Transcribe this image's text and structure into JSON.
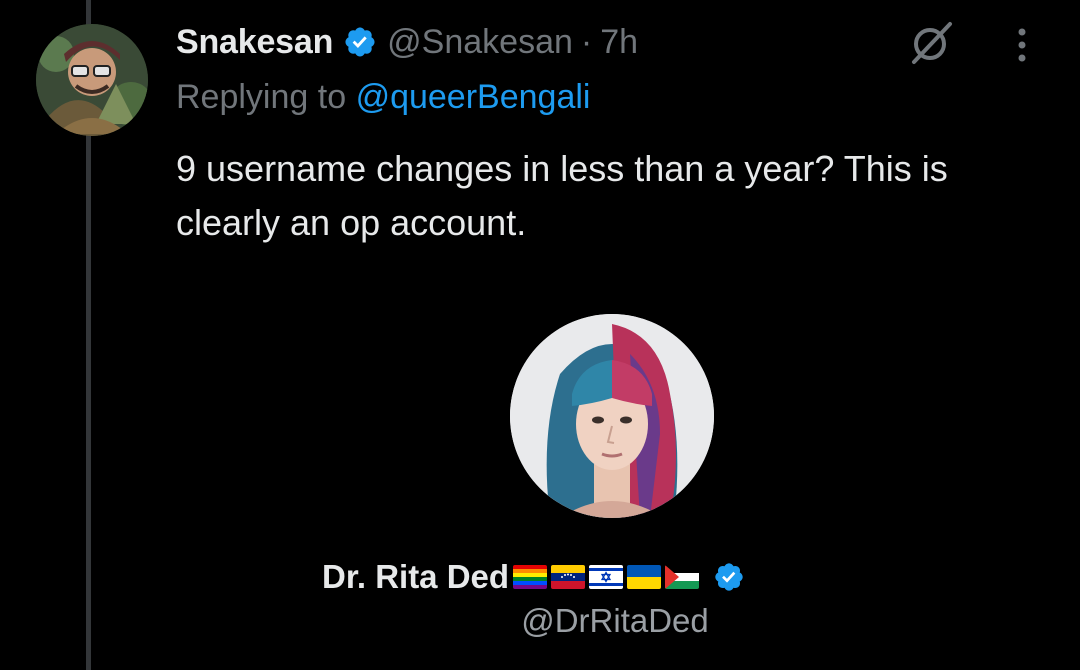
{
  "tweet": {
    "display_name": "Snakesan",
    "handle": "@Snakesan",
    "separator": "·",
    "time": "7h",
    "reply_prefix": "Replying to",
    "reply_handle": "@queerBengali",
    "text": "9 username changes in less than a year? This is clearly an op account.",
    "icons": {
      "verified": "verified-badge-icon",
      "grok": "grok-icon",
      "more": "more-vertical-icon"
    }
  },
  "embedded_profile": {
    "display_name": "Dr. Rita Ded",
    "handle": "@DrRitaDed",
    "flags": [
      "rainbow-flag",
      "venezuela-flag",
      "israel-flag",
      "ukraine-flag",
      "palestine-flag"
    ],
    "verified_icon": "verified-badge-icon"
  },
  "colors": {
    "background": "#000000",
    "text_primary": "#e7e9ea",
    "text_secondary": "#71767b",
    "link": "#1d9bf0",
    "verified": "#1d9bf0",
    "thread_line": "#333639"
  }
}
